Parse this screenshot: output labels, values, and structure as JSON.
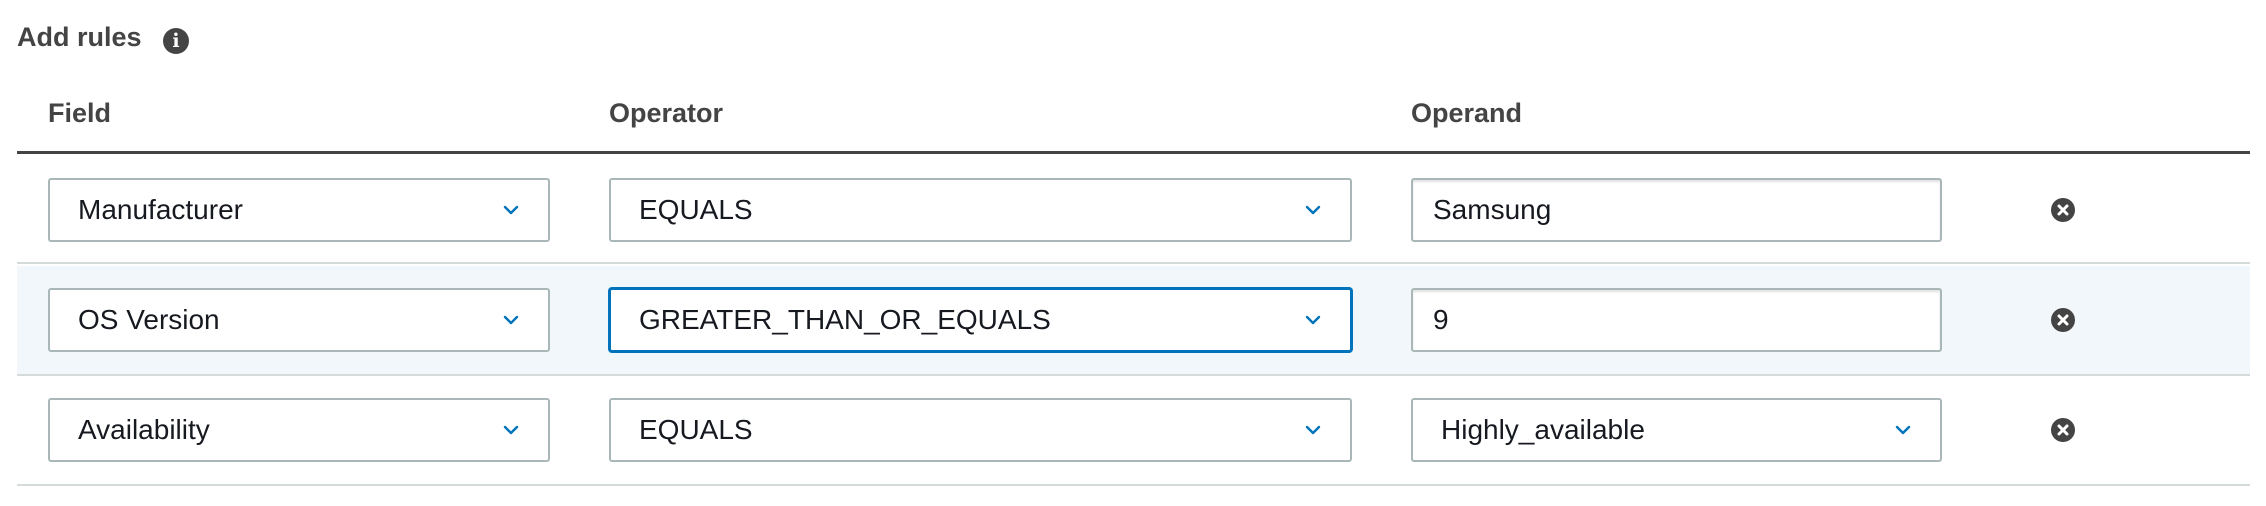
{
  "header": {
    "title": "Add rules",
    "info_icon": "info-icon"
  },
  "columns": {
    "field": "Field",
    "operator": "Operator",
    "operand": "Operand"
  },
  "rules": [
    {
      "field": "Manufacturer",
      "operator": "EQUALS",
      "operand": "Samsung",
      "operand_type": "text",
      "highlighted": false
    },
    {
      "field": "OS Version",
      "operator": "GREATER_THAN_OR_EQUALS",
      "operand": "9",
      "operand_type": "text",
      "highlighted": true
    },
    {
      "field": "Availability",
      "operator": "EQUALS",
      "operand": "Highly_available",
      "operand_type": "select",
      "highlighted": false
    }
  ],
  "icons": {
    "dropdown": "chevron-down-icon",
    "remove": "remove-circle-icon"
  },
  "colors": {
    "accent": "#0073bb",
    "text": "#16191f",
    "heading": "#444444",
    "border": "#aab7b8",
    "row_highlight": "#f1f7fa",
    "divider": "#d5dbdb"
  }
}
